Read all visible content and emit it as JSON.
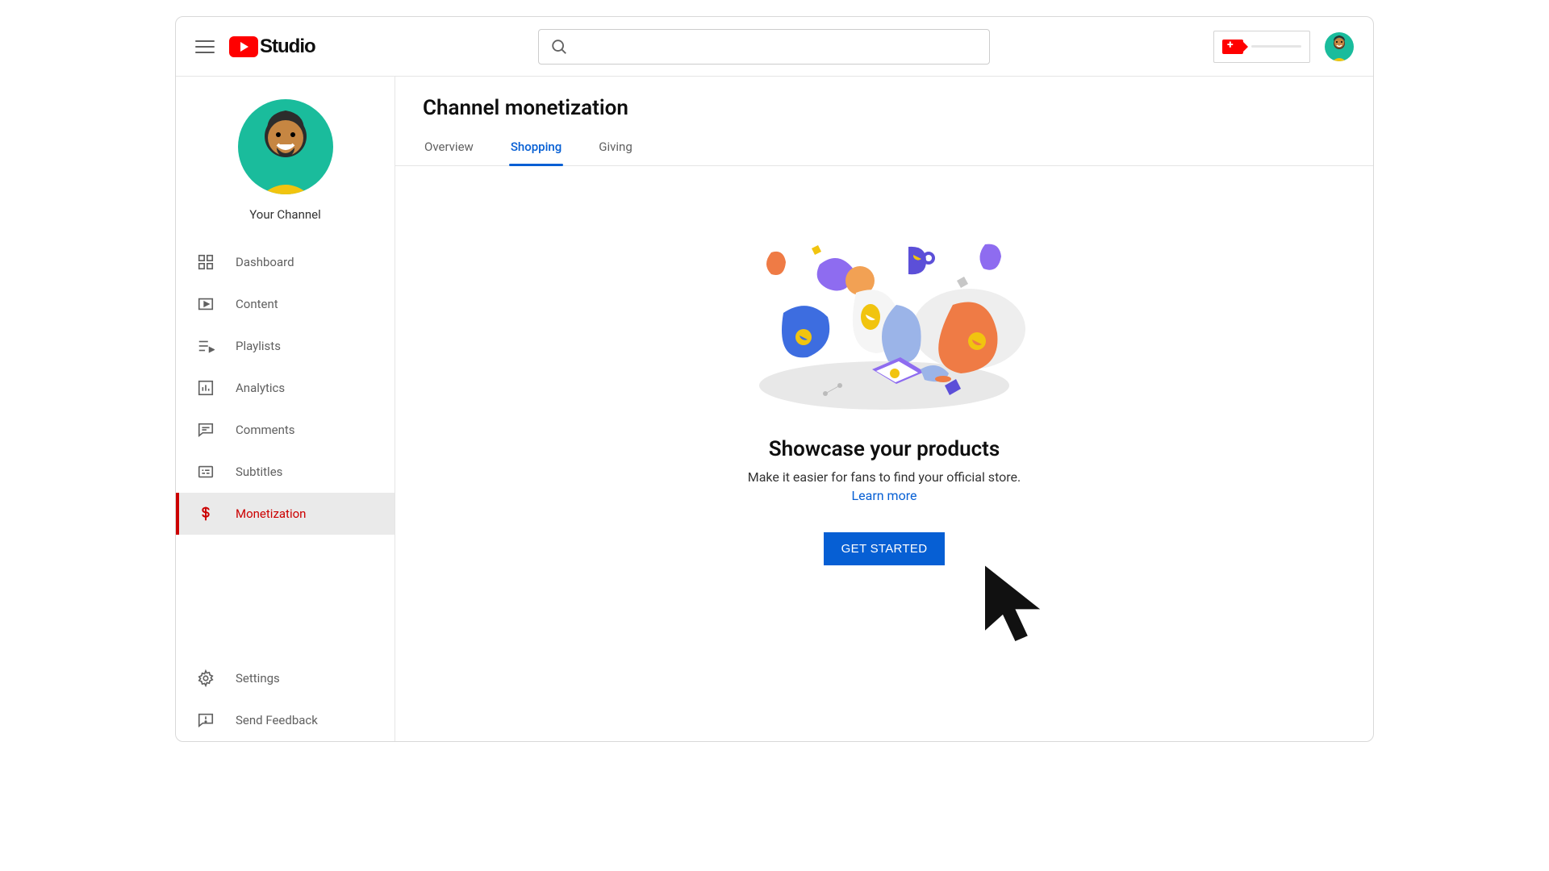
{
  "header": {
    "logo_text": "Studio",
    "search_placeholder": ""
  },
  "sidebar": {
    "channel_name": "Your Channel",
    "items": [
      {
        "label": "Dashboard"
      },
      {
        "label": "Content"
      },
      {
        "label": "Playlists"
      },
      {
        "label": "Analytics"
      },
      {
        "label": "Comments"
      },
      {
        "label": "Subtitles"
      },
      {
        "label": "Monetization"
      }
    ],
    "footer": [
      {
        "label": "Settings"
      },
      {
        "label": "Send Feedback"
      }
    ]
  },
  "page": {
    "title": "Channel monetization",
    "tabs": [
      {
        "label": "Overview"
      },
      {
        "label": "Shopping"
      },
      {
        "label": "Giving"
      }
    ],
    "active_tab": 1
  },
  "hero": {
    "title": "Showcase your products",
    "subtitle": "Make it easier for fans to find your official store.",
    "link_text": "Learn more",
    "cta": "GET STARTED"
  }
}
